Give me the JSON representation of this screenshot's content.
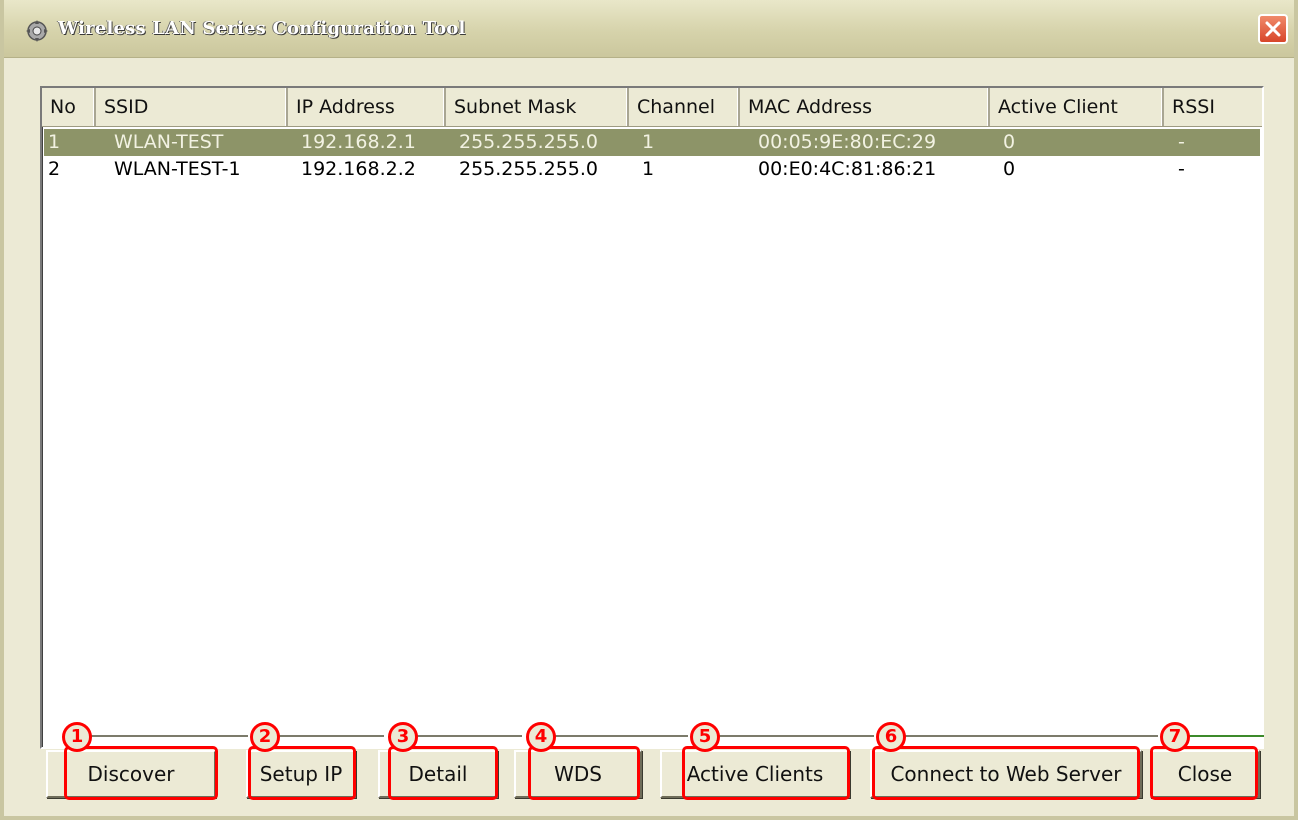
{
  "window": {
    "title": "Wireless LAN Series Configuration Tool"
  },
  "table": {
    "columns": [
      "No",
      "SSID",
      "IP Address",
      "Subnet Mask",
      "Channel",
      "MAC Address",
      "Active Client",
      "RSSI"
    ],
    "rows": [
      [
        "1",
        "WLAN-TEST",
        "192.168.2.1",
        "255.255.255.0",
        "1",
        "00:05:9E:80:EC:29",
        "0",
        "-"
      ],
      [
        "2",
        "WLAN-TEST-1",
        "192.168.2.2",
        "255.255.255.0",
        "1",
        "00:E0:4C:81:86:21",
        "0",
        "-"
      ]
    ],
    "selected_row": 0
  },
  "buttons": {
    "discover": "Discover",
    "setup_ip": "Setup IP",
    "detail": "Detail",
    "wds": "WDS",
    "active_clients": "Active Clients",
    "connect_web": "Connect to Web Server",
    "close": "Close"
  },
  "callouts": [
    "1",
    "2",
    "3",
    "4",
    "5",
    "6",
    "7"
  ],
  "colors": {
    "selection": "#8d9468",
    "annotation": "#ff0000",
    "face": "#ecead5"
  }
}
